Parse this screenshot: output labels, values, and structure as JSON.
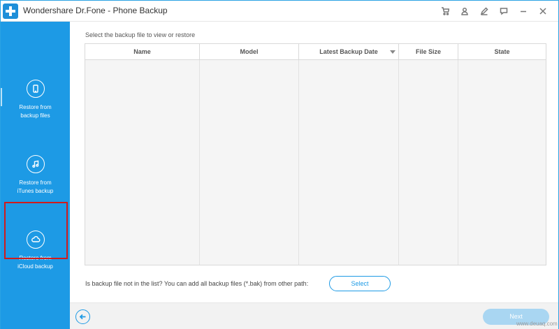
{
  "app": {
    "title": "Wondershare Dr.Fone - Phone Backup",
    "title_icons": [
      "cart-icon",
      "user-icon",
      "edit-icon",
      "feedback-icon",
      "minimize-icon",
      "close-icon"
    ]
  },
  "sidebar": {
    "items": [
      {
        "label": "Restore from\nbackup files",
        "icon": "phone-restore-icon"
      },
      {
        "label": "Restore from\niTunes backup",
        "icon": "music-restore-icon"
      },
      {
        "label": "Restore from\niCloud backup",
        "icon": "cloud-restore-icon"
      }
    ]
  },
  "main": {
    "instruction": "Select the backup file to view or restore",
    "table": {
      "columns": [
        "Name",
        "Model",
        "Latest Backup Date",
        "File Size",
        "State"
      ],
      "rows": []
    },
    "hint": "Is backup file not in the list? You can add all backup files (*.bak) from other path:",
    "select_label": "Select"
  },
  "footer": {
    "next_label": "Next"
  },
  "watermark": "www.deuaq.com",
  "colors": {
    "accent": "#1d9ae5",
    "highlight": "#d11a1a",
    "next_disabled": "#a9d6f2"
  }
}
